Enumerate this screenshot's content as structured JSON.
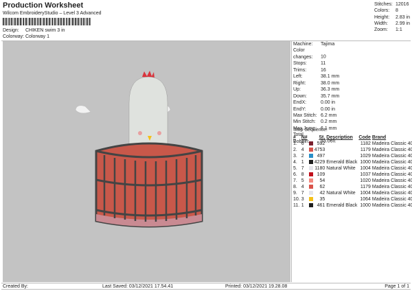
{
  "header": {
    "title": "Production Worksheet",
    "subtitle": "Wilcom EmbroideryStudio – Level 3 Advanced",
    "design_label": "Design:",
    "design": "CHIKEN swim 3 in",
    "colorway_label": "Colorway:",
    "colorway": "Colorway 1"
  },
  "stats": [
    {
      "label": "Stitches:",
      "value": "12016"
    },
    {
      "label": "Colors:",
      "value": "8"
    },
    {
      "label": "Height:",
      "value": "2.83 in"
    },
    {
      "label": "Width:",
      "value": "2.99 in"
    },
    {
      "label": "Zoom:",
      "value": "1:1"
    }
  ],
  "machine_info": [
    {
      "label": "Machine:",
      "value": "Tajima"
    },
    {
      "label": "Color changes:",
      "value": "10"
    },
    {
      "label": "Stops:",
      "value": "11"
    },
    {
      "label": "Trims:",
      "value": "16"
    },
    {
      "label": "Left:",
      "value": "38.1 mm"
    },
    {
      "label": "Right:",
      "value": "38.0 mm"
    },
    {
      "label": "Up:",
      "value": "36.3 mm"
    },
    {
      "label": "Down:",
      "value": "35.7 mm"
    },
    {
      "label": "EndX:",
      "value": "0.00 in"
    },
    {
      "label": "EndY:",
      "value": "0.00 in"
    },
    {
      "label": "Max Stitch:",
      "value": "6.2 mm"
    },
    {
      "label": "Min Stitch:",
      "value": "0.2 mm"
    },
    {
      "label": "Max Jump:",
      "value": "6.1 mm"
    },
    {
      "label": "Total Bobbin:",
      "value": "93.06ft"
    }
  ],
  "stop_sequence": {
    "title": "Stop Sequence:",
    "headers": [
      "#",
      "N#",
      "St.",
      "Description",
      "Code",
      "Brand"
    ],
    "rows": [
      {
        "n": "1.",
        "needle": "6",
        "color": "#7a1f2e",
        "st": "592",
        "desc": "",
        "code": "1182",
        "brand": "Madeira Classic 40"
      },
      {
        "n": "2.",
        "needle": "4",
        "color": "#d9534a",
        "st": "4753",
        "desc": "",
        "code": "1179",
        "brand": "Madeira Classic 40"
      },
      {
        "n": "3.",
        "needle": "2",
        "color": "#2a8fc8",
        "st": "497",
        "desc": "",
        "code": "1029",
        "brand": "Madeira Classic 40"
      },
      {
        "n": "4.",
        "needle": "1",
        "color": "#1e1e1e",
        "st": "4229",
        "desc": "Emerald Black",
        "code": "1000",
        "brand": "Madeira Classic 40"
      },
      {
        "n": "5.",
        "needle": "7",
        "color": "#e4e4ea",
        "st": "1180",
        "desc": "Natural White",
        "code": "1004",
        "brand": "Madeira Classic 40"
      },
      {
        "n": "6.",
        "needle": "8",
        "color": "#c0101c",
        "st": "109",
        "desc": "",
        "code": "1037",
        "brand": "Madeira Classic 40"
      },
      {
        "n": "7.",
        "needle": "5",
        "color": "#f48a80",
        "st": "54",
        "desc": "",
        "code": "1020",
        "brand": "Madeira Classic 40"
      },
      {
        "n": "8.",
        "needle": "4",
        "color": "#d9534a",
        "st": "62",
        "desc": "",
        "code": "1179",
        "brand": "Madeira Classic 40"
      },
      {
        "n": "9.",
        "needle": "7",
        "color": "#e4e4ea",
        "st": "42",
        "desc": "Natural White",
        "code": "1004",
        "brand": "Madeira Classic 40"
      },
      {
        "n": "10.",
        "needle": "3",
        "color": "#f5c018",
        "st": "35",
        "desc": "",
        "code": "1064",
        "brand": "Madeira Classic 40"
      },
      {
        "n": "11.",
        "needle": "1",
        "color": "#1e1e1e",
        "st": "461",
        "desc": "Emerald Black",
        "code": "1000",
        "brand": "Madeira Classic 40"
      }
    ]
  },
  "footer": {
    "created_by": "Created By:",
    "last_saved": "Last Saved: 03/12/2021 17.54.41",
    "printed": "Printed: 03/12/2021 19.28.08",
    "page": "Page 1 of 1"
  }
}
